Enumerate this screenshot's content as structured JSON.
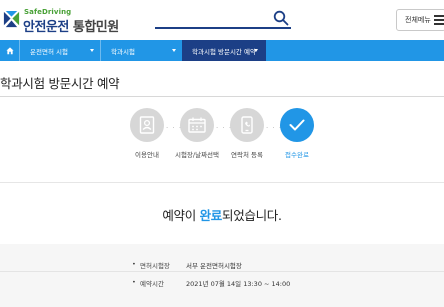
{
  "header": {
    "logo_sub": "SafeDriving",
    "logo_main": "안전운전",
    "logo_main2": "통합민원",
    "all_menu_label": "전체메뉴"
  },
  "nav": {
    "items": [
      {
        "label": "운전면허 시험"
      },
      {
        "label": "학과시험"
      },
      {
        "label": "학과시험 방문시간 예약"
      }
    ]
  },
  "page": {
    "title": "학과시험 방문시간 예약"
  },
  "steps": [
    {
      "label": "이용안내",
      "icon": "document-user-icon",
      "active": false
    },
    {
      "label": "시험장/날짜선택",
      "icon": "calendar-icon",
      "active": false
    },
    {
      "label": "연락처 등록",
      "icon": "phone-icon",
      "active": false
    },
    {
      "label": "접수완료",
      "icon": "check-icon",
      "active": true
    }
  ],
  "result": {
    "msg_prefix": "예약이 ",
    "msg_highlight": "완료",
    "msg_suffix": "되었습니다.",
    "rows": [
      {
        "label": "면허시험장",
        "value": "서부 운전면허시험장"
      },
      {
        "label": "예약시간",
        "value": "2021년 07월 14일 13:30 ~ 14:00"
      }
    ]
  },
  "colors": {
    "brand_navy": "#1c3f86",
    "brand_blue": "#2196e6",
    "brand_green": "#49a137",
    "step_inactive": "#d7d7d7"
  }
}
